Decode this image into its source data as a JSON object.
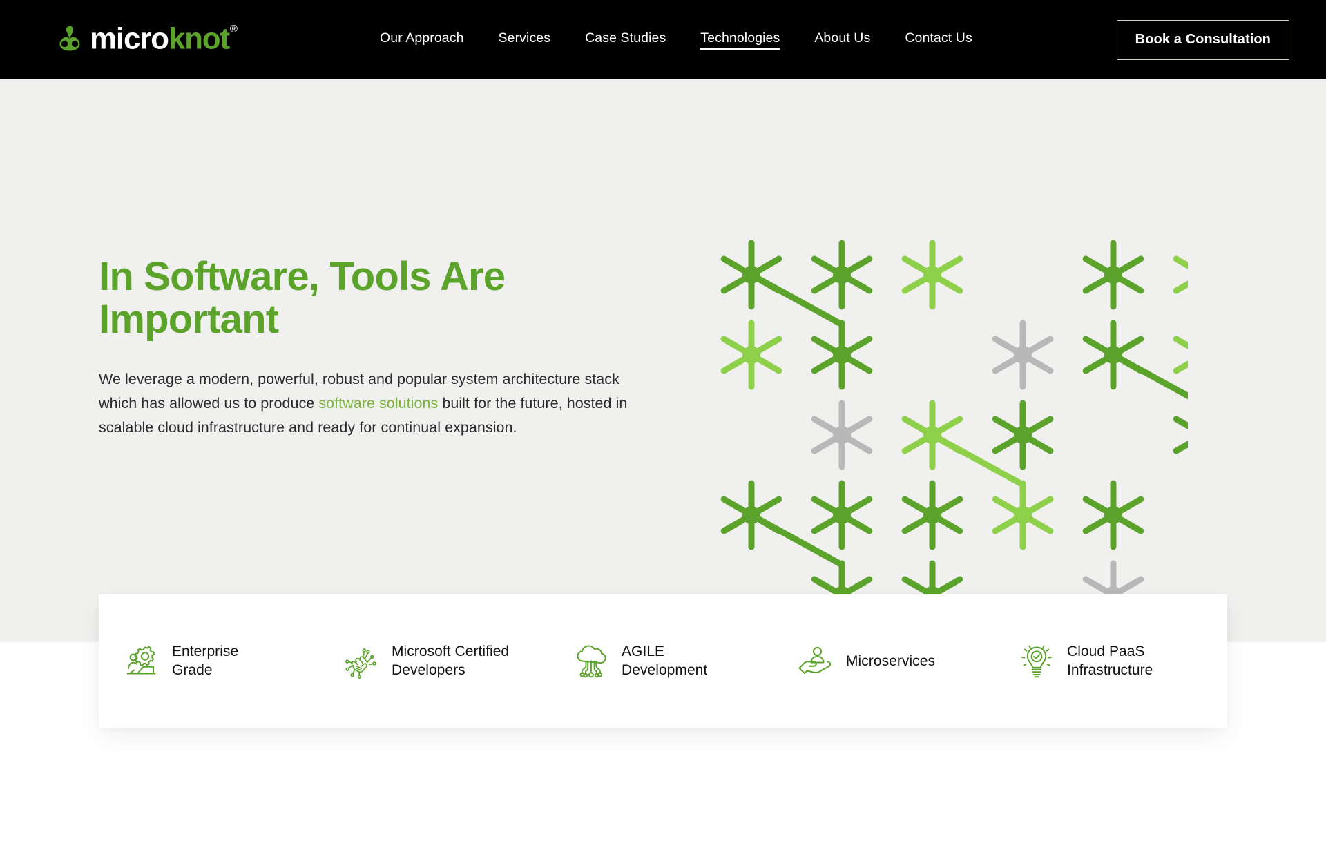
{
  "brand": {
    "logo_micro": "micro",
    "logo_knot": "knot",
    "logo_registered": "®",
    "knot_icon": "ampersand-knot-icon"
  },
  "colors": {
    "brand_green": "#5ba32b",
    "light_green": "#8fd04b",
    "link_green": "#7bb53f",
    "gray_star": "#b8b8b8",
    "header_bg": "#000000",
    "hero_bg": "#f0f0ef",
    "card_bg": "#ffffff",
    "body_text": "#2b2b2b"
  },
  "nav": {
    "items": [
      {
        "label": "Our Approach",
        "active": false
      },
      {
        "label": "Services",
        "active": false
      },
      {
        "label": "Case Studies",
        "active": false
      },
      {
        "label": "Technologies",
        "active": true
      },
      {
        "label": "About Us",
        "active": false
      },
      {
        "label": "Contact Us",
        "active": false
      }
    ],
    "cta_label": "Book a Consultation"
  },
  "hero": {
    "title": "In Software, Tools Are Important",
    "paragraph_part_1": "We leverage a modern, powerful, robust and popular system architecture stack which has allowed us to produce ",
    "paragraph_link": "software solutions",
    "paragraph_part_2": " built for the future, hosted in scalable cloud infrastructure and ready for continual expansion."
  },
  "graphic": {
    "description": "network-of-stars",
    "stars": [
      {
        "col": 1,
        "row": 1,
        "tone": "dark"
      },
      {
        "col": 2,
        "row": 1,
        "tone": "dark"
      },
      {
        "col": 3,
        "row": 1,
        "tone": "light"
      },
      {
        "col": 5,
        "row": 1,
        "tone": "dark"
      },
      {
        "col": 6,
        "row": 1,
        "tone": "light"
      },
      {
        "col": 1,
        "row": 2,
        "tone": "light"
      },
      {
        "col": 2,
        "row": 2,
        "tone": "dark"
      },
      {
        "col": 4,
        "row": 2,
        "tone": "gray"
      },
      {
        "col": 5,
        "row": 2,
        "tone": "dark"
      },
      {
        "col": 6,
        "row": 2,
        "tone": "light"
      },
      {
        "col": 2,
        "row": 3,
        "tone": "gray"
      },
      {
        "col": 3,
        "row": 3,
        "tone": "light"
      },
      {
        "col": 4,
        "row": 3,
        "tone": "dark"
      },
      {
        "col": 6,
        "row": 3,
        "tone": "dark"
      },
      {
        "col": 1,
        "row": 4,
        "tone": "dark"
      },
      {
        "col": 2,
        "row": 4,
        "tone": "dark"
      },
      {
        "col": 3,
        "row": 4,
        "tone": "dark"
      },
      {
        "col": 4,
        "row": 4,
        "tone": "light"
      },
      {
        "col": 5,
        "row": 4,
        "tone": "dark"
      },
      {
        "col": 2,
        "row": 5,
        "tone": "dark"
      },
      {
        "col": 3,
        "row": 5,
        "tone": "dark"
      },
      {
        "col": 5,
        "row": 5,
        "tone": "gray"
      }
    ],
    "connections": [
      {
        "from_col": 1,
        "from_row": 1,
        "to_col": 2,
        "to_row": 2,
        "tone": "dark"
      },
      {
        "from_col": 5,
        "from_row": 2,
        "to_col": 6,
        "to_row": 3,
        "tone": "dark"
      },
      {
        "from_col": 3,
        "from_row": 3,
        "to_col": 4,
        "to_row": 4,
        "tone": "light"
      },
      {
        "from_col": 1,
        "from_row": 4,
        "to_col": 2,
        "to_row": 5,
        "tone": "dark"
      }
    ]
  },
  "features": [
    {
      "label": "Enterprise\nGrade",
      "icon": "gear-team-icon"
    },
    {
      "label": "Microsoft Certified\nDevelopers",
      "icon": "circuit-hand-icon"
    },
    {
      "label": "AGILE\nDevelopment",
      "icon": "cloud-circuit-icon"
    },
    {
      "label": "Microservices",
      "icon": "hand-person-icon"
    },
    {
      "label": "Cloud PaaS\nInfrastructure",
      "icon": "lightbulb-check-icon"
    }
  ]
}
